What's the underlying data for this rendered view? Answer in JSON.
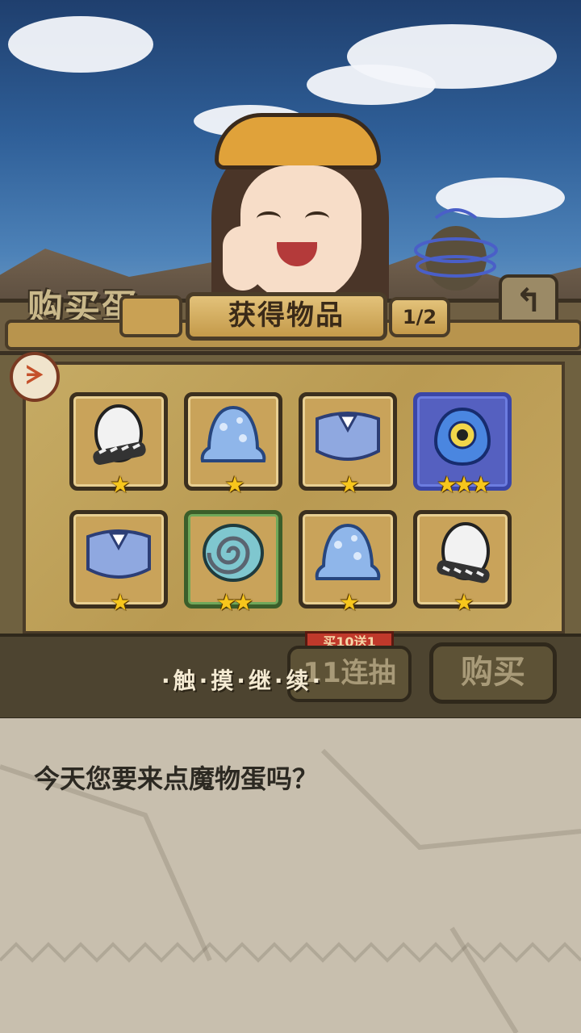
{
  "header": {
    "shop_title": "购买蛋",
    "panel_title": "获得物品",
    "page_indicator": "1/2",
    "back_icon": "return-arrow-icon"
  },
  "rewards": [
    {
      "item": "white-striped-egg",
      "stars": "★"
    },
    {
      "item": "blue-slime-egg",
      "stars": "★"
    },
    {
      "item": "blue-furry-egg",
      "stars": "★"
    },
    {
      "item": "blue-eyeball-egg",
      "stars": "★★★",
      "rarity": "blue"
    },
    {
      "item": "blue-furry-egg",
      "stars": "★"
    },
    {
      "item": "spiral-shell-egg",
      "stars": "★★",
      "rarity": "green"
    },
    {
      "item": "blue-slime-egg",
      "stars": "★"
    },
    {
      "item": "white-striped-egg",
      "stars": "★"
    }
  ],
  "actions": {
    "ten_banner": "买10送1",
    "eleven_label": "11连抽",
    "buy_label": "购买",
    "touch_continue": "·触·摸·继·续·"
  },
  "dialog": {
    "text": "今天您要来点魔物蛋吗？"
  },
  "colors": {
    "gold": "#c49a4a",
    "dark_wood": "#3a3022",
    "star": "#f7c61c",
    "rare_blue": "#3a46a8",
    "rare_green": "#3b5e2a"
  }
}
